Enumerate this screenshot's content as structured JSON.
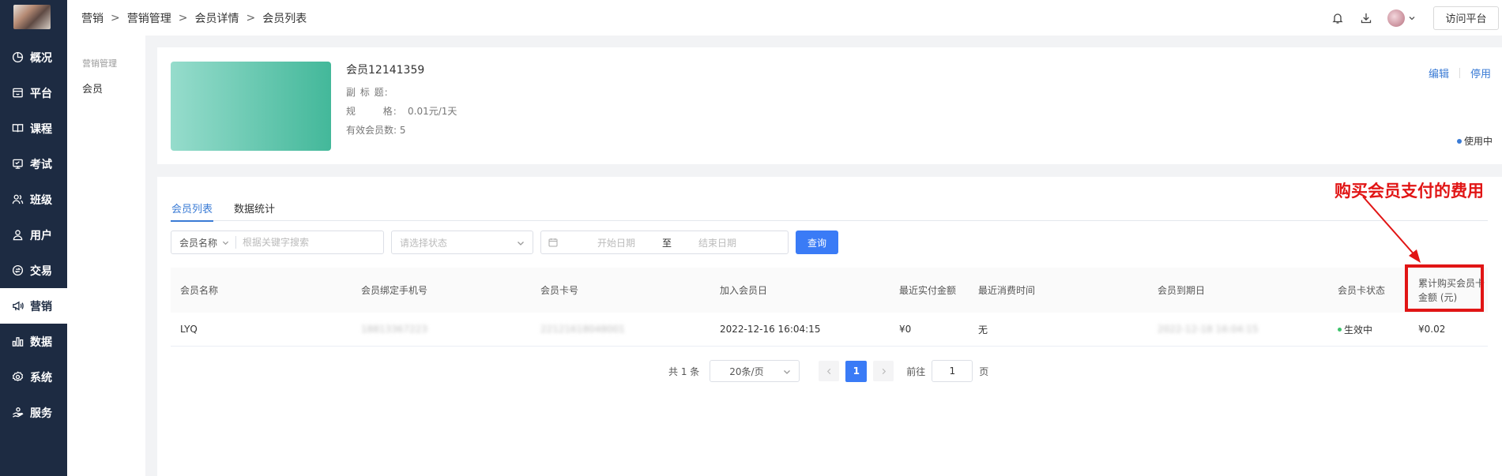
{
  "sidebar": {
    "items": [
      {
        "label": "概况",
        "icon": "pie-chart-icon"
      },
      {
        "label": "平台",
        "icon": "storefront-icon"
      },
      {
        "label": "课程",
        "icon": "book-icon"
      },
      {
        "label": "考试",
        "icon": "exam-icon"
      },
      {
        "label": "班级",
        "icon": "class-icon"
      },
      {
        "label": "用户",
        "icon": "user-icon"
      },
      {
        "label": "交易",
        "icon": "trade-icon"
      },
      {
        "label": "营销",
        "icon": "megaphone-icon",
        "active": true
      },
      {
        "label": "数据",
        "icon": "bar-chart-icon"
      },
      {
        "label": "系统",
        "icon": "gear-icon"
      },
      {
        "label": "服务",
        "icon": "service-icon"
      }
    ]
  },
  "header": {
    "breadcrumb": [
      "营销",
      "营销管理",
      "会员详情",
      "会员列表"
    ],
    "visit_button": "访问平台"
  },
  "submenu": {
    "group": "营销管理",
    "item": "会员"
  },
  "member_card": {
    "name": "会员12141359",
    "subtitle_label": "副 标 题:",
    "subtitle_value": "",
    "spec_label": "规       格:",
    "spec_value": "0.01元/1天",
    "count_label": "有效会员数:",
    "count_value": "5",
    "edit": "编辑",
    "disable": "停用",
    "status": "使用中"
  },
  "tabs": [
    "会员列表",
    "数据统计"
  ],
  "filters": {
    "field_select": "会员名称",
    "keyword_placeholder": "根据关键字搜索",
    "status_placeholder": "请选择状态",
    "start_placeholder": "开始日期",
    "to": "至",
    "end_placeholder": "结束日期",
    "query": "查询"
  },
  "table": {
    "columns": [
      "会员名称",
      "会员绑定手机号",
      "会员卡号",
      "加入会员日",
      "最近实付金额",
      "最近消费时间",
      "会员到期日",
      "会员卡状态",
      "累计购买会员卡金额 (元)"
    ],
    "rows": [
      {
        "name": "LYQ",
        "phone": "18813367223",
        "card_no": "22121618048001",
        "join_date": "2022-12-16 16:04:15",
        "last_paid": "¥0",
        "last_time": "无",
        "expire": "2022-12-18 16:04:15",
        "status": "生效中",
        "total": "¥0.02"
      }
    ]
  },
  "pagination": {
    "total": "共 1 条",
    "page_size": "20条/页",
    "current": "1",
    "goto": "前往",
    "goto_value": "1",
    "page_unit": "页"
  },
  "annotation": {
    "text": "购买会员支付的费用",
    "color": "#e11515"
  },
  "colors": {
    "sidebar_bg": "#1d2b42",
    "accent": "#3a7bf6",
    "success": "#3ec26b"
  }
}
